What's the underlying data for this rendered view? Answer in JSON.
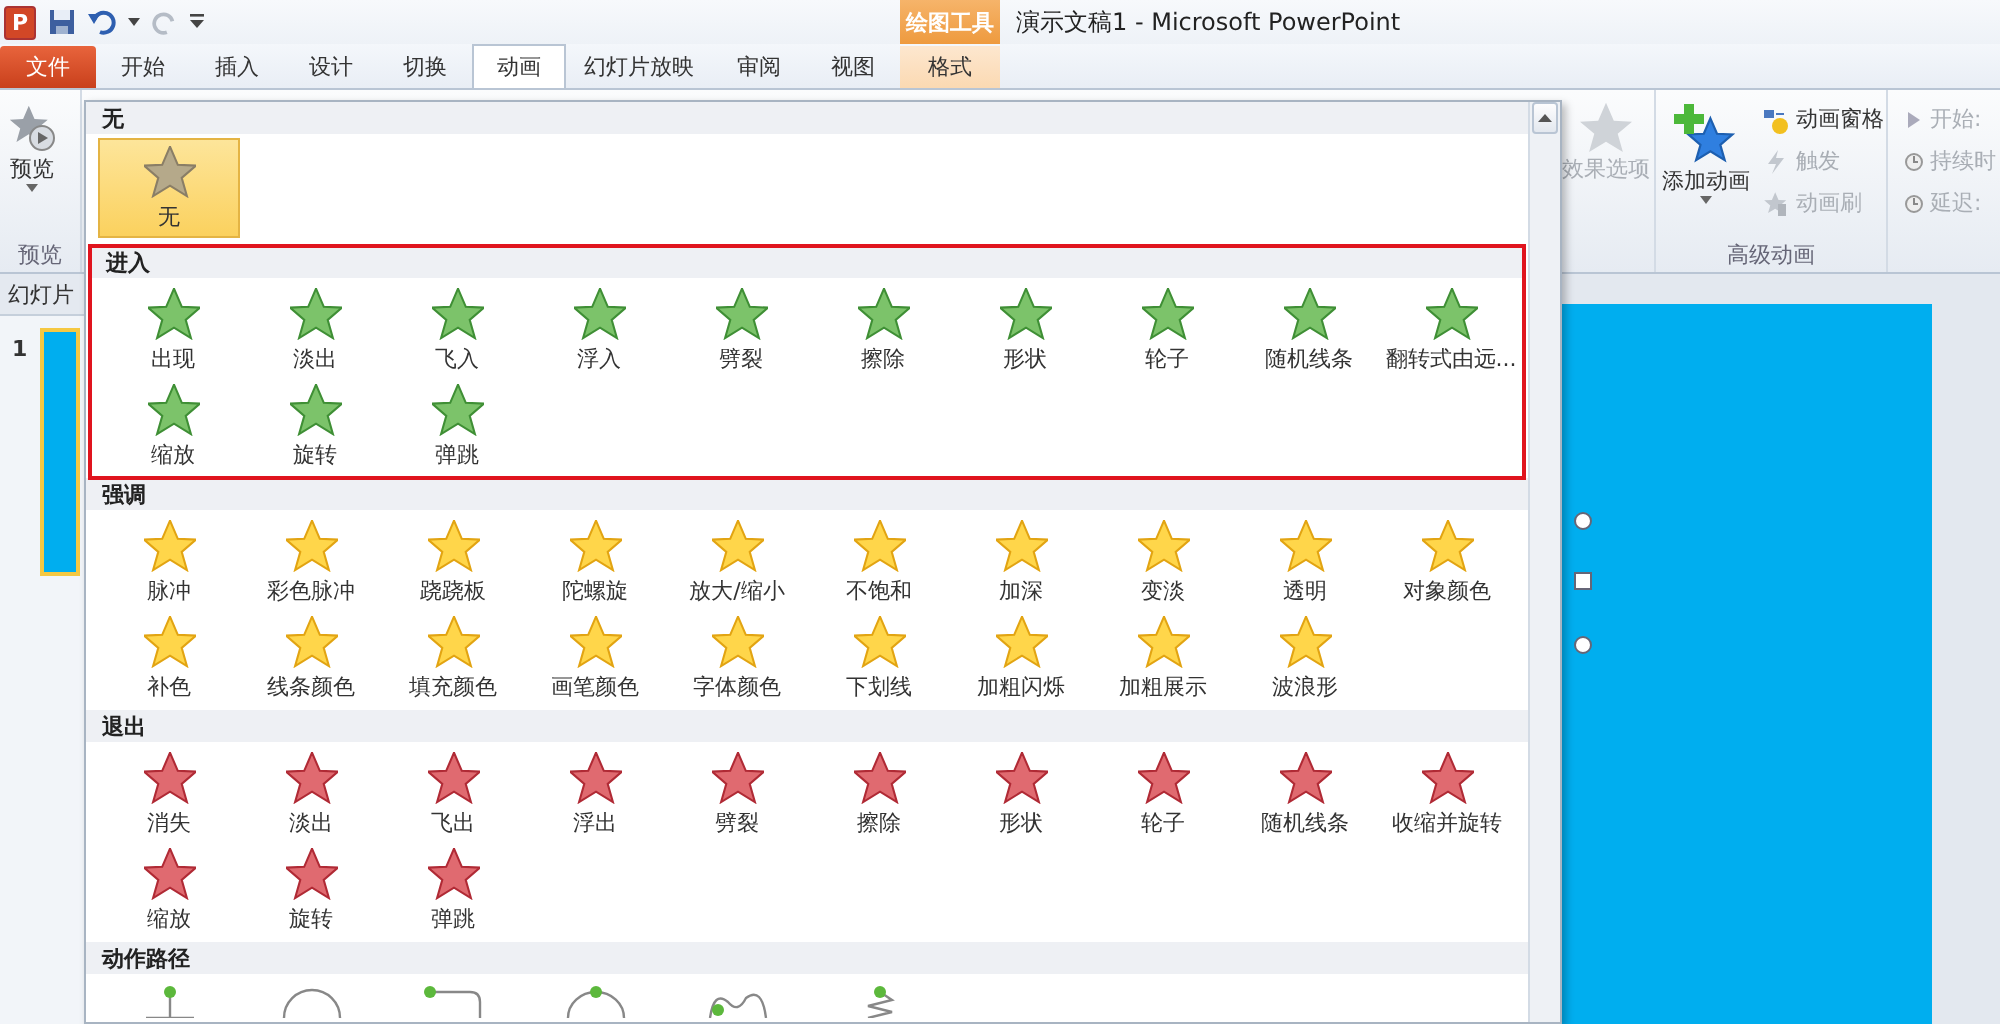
{
  "quick_access": {
    "logo_letter": "P"
  },
  "context_group": {
    "label": "绘图工具"
  },
  "window": {
    "title": "演示文稿1  -  Microsoft PowerPoint"
  },
  "tabs": [
    {
      "label": "文件",
      "kind": "file",
      "selected": false
    },
    {
      "label": "开始",
      "kind": "normal",
      "selected": false
    },
    {
      "label": "插入",
      "kind": "normal",
      "selected": false
    },
    {
      "label": "设计",
      "kind": "normal",
      "selected": false
    },
    {
      "label": "切换",
      "kind": "normal",
      "selected": false
    },
    {
      "label": "动画",
      "kind": "normal",
      "selected": true
    },
    {
      "label": "幻灯片放映",
      "kind": "normal",
      "selected": false
    },
    {
      "label": "审阅",
      "kind": "normal",
      "selected": false
    },
    {
      "label": "视图",
      "kind": "normal",
      "selected": false
    },
    {
      "label": "格式",
      "kind": "context",
      "selected": false
    }
  ],
  "ribbon": {
    "preview": {
      "button": "预览",
      "group": "预览"
    },
    "effect_options": {
      "label": "效果选项",
      "disabled": true
    },
    "advanced": {
      "add_button": "添加动画",
      "group": "高级动画",
      "items": [
        {
          "label": "动画窗格",
          "kind": "pane",
          "disabled": false
        },
        {
          "label": "触发",
          "kind": "trigger",
          "disabled": true
        },
        {
          "label": "动画刷",
          "kind": "brush",
          "disabled": true
        }
      ]
    },
    "timing": [
      {
        "label": "开始:",
        "kind": "start",
        "disabled": true
      },
      {
        "label": "持续时",
        "kind": "duration",
        "disabled": true
      },
      {
        "label": "延迟:",
        "kind": "delay",
        "disabled": true
      }
    ]
  },
  "gallery": {
    "sections": [
      {
        "title": "无",
        "kind": "none",
        "highlighted": false,
        "items": [
          {
            "label": "无",
            "selected": true
          }
        ]
      },
      {
        "title": "进入",
        "kind": "entrance",
        "highlighted": true,
        "items": [
          {
            "label": "出现",
            "selected": false
          },
          {
            "label": "淡出",
            "selected": false
          },
          {
            "label": "飞入",
            "selected": false
          },
          {
            "label": "浮入",
            "selected": false
          },
          {
            "label": "劈裂",
            "selected": false
          },
          {
            "label": "擦除",
            "selected": false
          },
          {
            "label": "形状",
            "selected": false
          },
          {
            "label": "轮子",
            "selected": false
          },
          {
            "label": "随机线条",
            "selected": false
          },
          {
            "label": "翻转式由远...",
            "selected": false
          },
          {
            "label": "缩放",
            "selected": false
          },
          {
            "label": "旋转",
            "selected": false
          },
          {
            "label": "弹跳",
            "selected": false
          }
        ]
      },
      {
        "title": "强调",
        "kind": "emphasis",
        "highlighted": false,
        "items": [
          {
            "label": "脉冲",
            "selected": false
          },
          {
            "label": "彩色脉冲",
            "selected": false
          },
          {
            "label": "跷跷板",
            "selected": false
          },
          {
            "label": "陀螺旋",
            "selected": false
          },
          {
            "label": "放大/缩小",
            "selected": false
          },
          {
            "label": "不饱和",
            "selected": false
          },
          {
            "label": "加深",
            "selected": false
          },
          {
            "label": "变淡",
            "selected": false
          },
          {
            "label": "透明",
            "selected": false
          },
          {
            "label": "对象颜色",
            "selected": false
          },
          {
            "label": "补色",
            "selected": false
          },
          {
            "label": "线条颜色",
            "selected": false
          },
          {
            "label": "填充颜色",
            "selected": false
          },
          {
            "label": "画笔颜色",
            "selected": false
          },
          {
            "label": "字体颜色",
            "selected": false
          },
          {
            "label": "下划线",
            "selected": false
          },
          {
            "label": "加粗闪烁",
            "selected": false
          },
          {
            "label": "加粗展示",
            "selected": false
          },
          {
            "label": "波浪形",
            "selected": false
          }
        ]
      },
      {
        "title": "退出",
        "kind": "exit",
        "highlighted": false,
        "items": [
          {
            "label": "消失",
            "selected": false
          },
          {
            "label": "淡出",
            "selected": false
          },
          {
            "label": "飞出",
            "selected": false
          },
          {
            "label": "浮出",
            "selected": false
          },
          {
            "label": "劈裂",
            "selected": false
          },
          {
            "label": "擦除",
            "selected": false
          },
          {
            "label": "形状",
            "selected": false
          },
          {
            "label": "轮子",
            "selected": false
          },
          {
            "label": "随机线条",
            "selected": false
          },
          {
            "label": "收缩并旋转",
            "selected": false
          },
          {
            "label": "缩放",
            "selected": false
          },
          {
            "label": "旋转",
            "selected": false
          },
          {
            "label": "弹跳",
            "selected": false
          }
        ]
      },
      {
        "title": "动作路径",
        "kind": "path",
        "highlighted": false,
        "items": [
          {
            "kind": "line",
            "selected": false
          },
          {
            "kind": "circle",
            "selected": false
          },
          {
            "kind": "turn",
            "selected": false
          },
          {
            "kind": "arc",
            "selected": false
          },
          {
            "kind": "loops",
            "selected": false
          },
          {
            "kind": "spiral",
            "selected": false
          }
        ]
      }
    ]
  },
  "slides_pane": {
    "tab": "幻灯片",
    "thumbnails": [
      {
        "number": "1",
        "selected": true
      }
    ]
  }
}
